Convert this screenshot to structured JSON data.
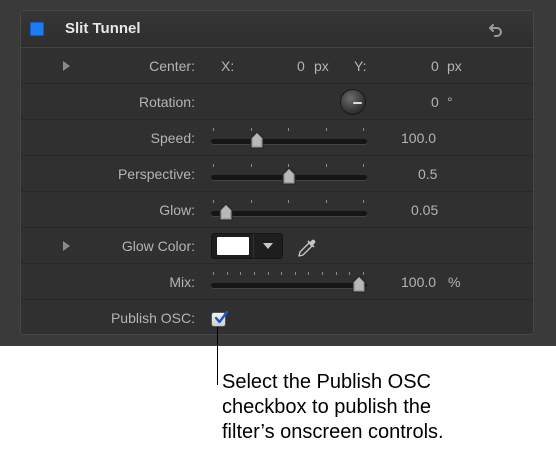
{
  "panel": {
    "title": "Slit Tunnel",
    "accent_color": "#1e7cf3"
  },
  "center": {
    "label": "Center:",
    "x_label": "X:",
    "x_value": "0",
    "x_unit": "px",
    "y_label": "Y:",
    "y_value": "0",
    "y_unit": "px"
  },
  "rotation": {
    "label": "Rotation:",
    "value": "0",
    "unit": "°"
  },
  "speed": {
    "label": "Speed:",
    "value": "100.0",
    "slider_fraction": 0.27
  },
  "perspective": {
    "label": "Perspective:",
    "value": "0.5",
    "slider_fraction": 0.5
  },
  "glow": {
    "label": "Glow:",
    "value": "0.05",
    "slider_fraction": 0.05
  },
  "glow_color": {
    "label": "Glow Color:",
    "color": "#ffffff"
  },
  "mix": {
    "label": "Mix:",
    "value": "100.0",
    "unit": "%",
    "slider_fraction": 1.0
  },
  "publish_osc": {
    "label": "Publish OSC:",
    "checked": true
  },
  "callout": {
    "text_lines": [
      "Select the Publish OSC",
      "checkbox to publish the",
      "filter’s onscreen controls."
    ]
  }
}
